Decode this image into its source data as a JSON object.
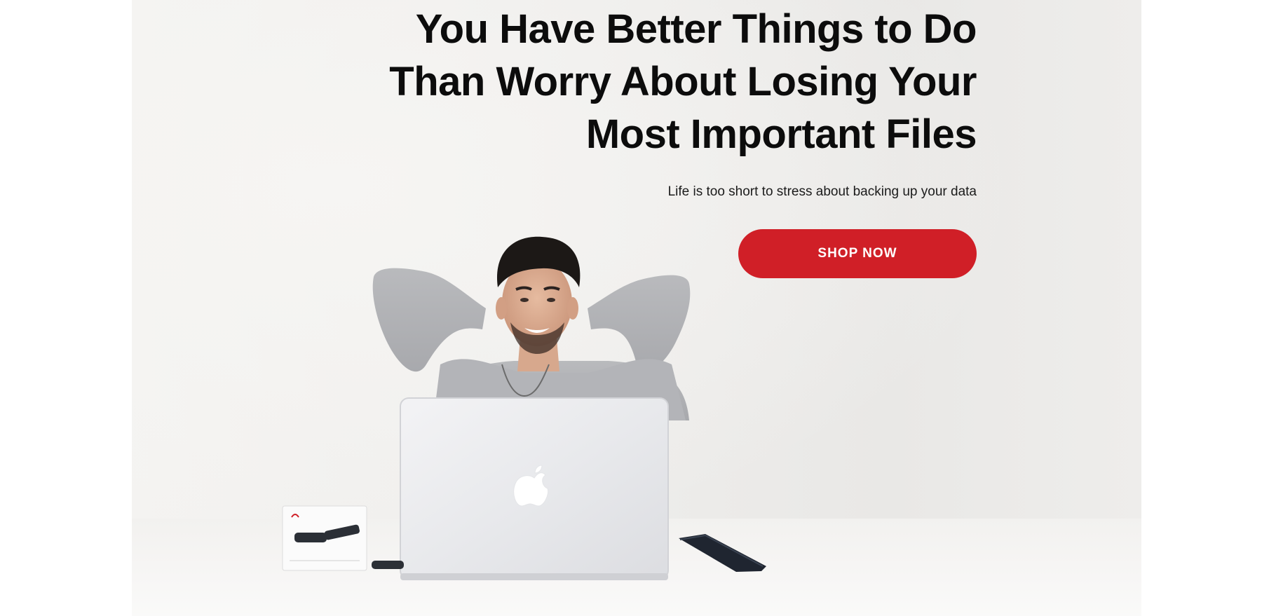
{
  "hero": {
    "headline": "You Have Better Things to Do Than Worry About Losing Your Most Important Files",
    "subheadline": "Life is too short to stress about backing up your data",
    "cta_label": "SHOP NOW"
  },
  "colors": {
    "accent": "#d01f27",
    "headline_text": "#0c0c0c",
    "background": "#efeeec"
  },
  "icons": {
    "laptop_logo": "apple-logo-icon"
  }
}
